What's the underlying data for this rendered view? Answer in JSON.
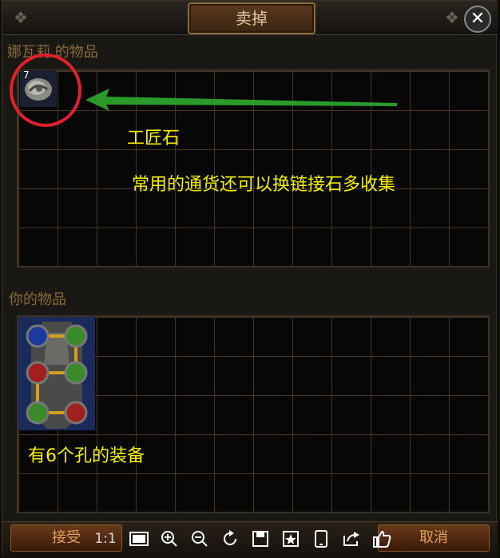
{
  "window": {
    "title": "卖掉",
    "close_label": "✕"
  },
  "sections": {
    "vendor_label": "娜瓦莉 的物品",
    "player_label": "你的物品"
  },
  "vendor_item": {
    "name": "工匠石",
    "stack_count": "7"
  },
  "annotations": {
    "item_name": "工匠石",
    "item_note": "常用的通货还可以换链接石多收集",
    "player_item_note": "有6个孔的装备"
  },
  "buttons": {
    "accept": "接受",
    "cancel": "取消"
  },
  "toolbar": {
    "ratio": "1:1",
    "icons": [
      "fullscreen-icon",
      "zoom-in-icon",
      "zoom-out-icon",
      "rotate-icon",
      "save-icon",
      "bookmark-icon",
      "phone-icon",
      "share-icon",
      "like-icon"
    ]
  },
  "colors": {
    "annotation": "#f4f000",
    "highlight": "#e0202a",
    "arrow": "#2a9a2a",
    "label": "#8a6a3a"
  }
}
